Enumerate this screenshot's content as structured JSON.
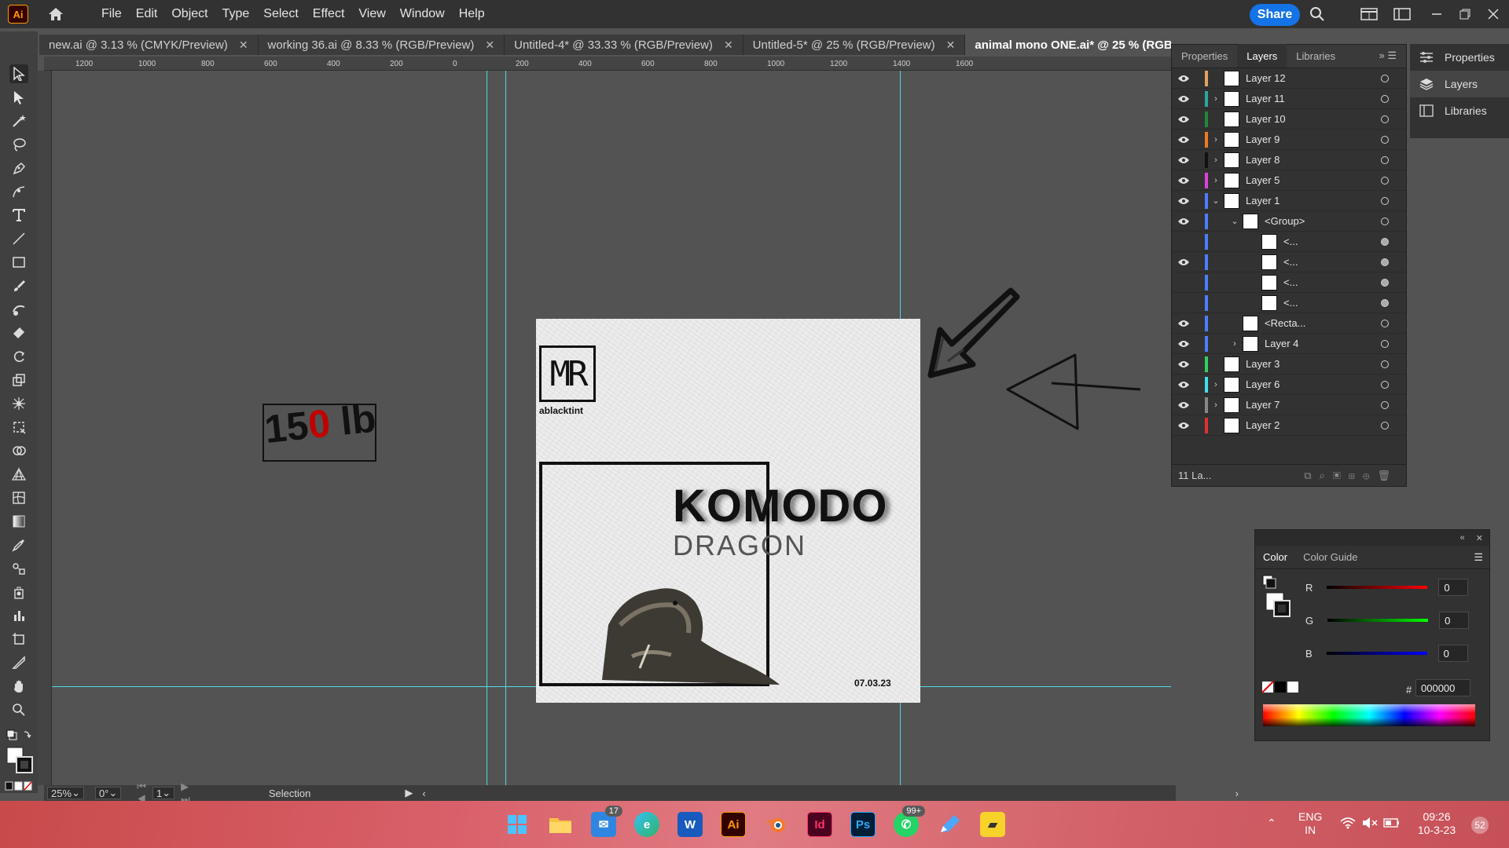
{
  "app": {
    "logo": "Ai"
  },
  "menu": [
    "File",
    "Edit",
    "Object",
    "Type",
    "Select",
    "Effect",
    "View",
    "Window",
    "Help"
  ],
  "share_label": "Share",
  "tabs": [
    {
      "label": "new.ai @ 3.13 % (CMYK/Preview)"
    },
    {
      "label": "working 36.ai @ 8.33 % (RGB/Preview)"
    },
    {
      "label": "Untitled-4* @ 33.33 % (RGB/Preview)"
    },
    {
      "label": "Untitled-5* @ 25 % (RGB/Preview)"
    },
    {
      "label": "animal mono ONE.ai* @ 25 % (RGB/Preview)"
    }
  ],
  "ruler_ticks": [
    "1200",
    "1000",
    "800",
    "600",
    "400",
    "200",
    "0",
    "200",
    "400",
    "600",
    "800",
    "1000",
    "1200",
    "1400",
    "1600"
  ],
  "artboard": {
    "logo_mark": "MR",
    "logo_text": "ablacktint",
    "title": "KOMODO",
    "subtitle": "DRAGON",
    "date": "07.03.23"
  },
  "weight_label": {
    "before": "15",
    "zero": "0",
    "after": " lb"
  },
  "statusbar": {
    "zoom": "25%",
    "rotation": "0°",
    "artboard_num": "1",
    "tool": "Selection"
  },
  "panel_tabs": [
    "Properties",
    "Layers",
    "Libraries"
  ],
  "layers": [
    {
      "name": "Layer 12",
      "color": "#e2a060",
      "indent": 0,
      "expand": "",
      "visible": true
    },
    {
      "name": "Layer 11",
      "color": "#2aa6a0",
      "indent": 0,
      "expand": "›",
      "visible": true
    },
    {
      "name": "Layer 10",
      "color": "#1e8a3a",
      "indent": 0,
      "expand": "",
      "visible": true
    },
    {
      "name": "Layer 9",
      "color": "#f07a20",
      "indent": 0,
      "expand": "›",
      "visible": true
    },
    {
      "name": "Layer 8",
      "color": "#111111",
      "indent": 0,
      "expand": "›",
      "visible": true
    },
    {
      "name": "Layer 5",
      "color": "#e040e0",
      "indent": 0,
      "expand": "›",
      "visible": true
    },
    {
      "name": "Layer 1",
      "color": "#4a7fff",
      "indent": 0,
      "expand": "⌄",
      "visible": true
    },
    {
      "name": "<Group>",
      "color": "#4a7fff",
      "indent": 1,
      "expand": "⌄",
      "visible": true
    },
    {
      "name": "<...",
      "color": "#4a7fff",
      "indent": 2,
      "expand": "",
      "visible": false
    },
    {
      "name": "<...",
      "color": "#4a7fff",
      "indent": 2,
      "expand": "",
      "visible": true
    },
    {
      "name": "<...",
      "color": "#4a7fff",
      "indent": 2,
      "expand": "",
      "visible": false
    },
    {
      "name": "<...",
      "color": "#4a7fff",
      "indent": 2,
      "expand": "",
      "visible": false
    },
    {
      "name": "<Recta...",
      "color": "#4a7fff",
      "indent": 1,
      "expand": "",
      "visible": true
    },
    {
      "name": "Layer 4",
      "color": "#4a7fff",
      "indent": 1,
      "expand": "›",
      "visible": true
    },
    {
      "name": "Layer 3",
      "color": "#30d060",
      "indent": 0,
      "expand": "",
      "visible": true
    },
    {
      "name": "Layer 6",
      "color": "#40e0f0",
      "indent": 0,
      "expand": "›",
      "visible": true
    },
    {
      "name": "Layer 7",
      "color": "#888888",
      "indent": 0,
      "expand": "›",
      "visible": true
    },
    {
      "name": "Layer 2",
      "color": "#e03030",
      "indent": 0,
      "expand": "",
      "visible": true
    }
  ],
  "layers_count": "11 La...",
  "dock": [
    "Properties",
    "Layers",
    "Libraries"
  ],
  "color_panel": {
    "tabs": [
      "Color",
      "Color Guide"
    ],
    "r": "0",
    "g": "0",
    "b": "0",
    "hex": "000000",
    "labels": {
      "r": "R",
      "g": "G",
      "b": "B",
      "hash": "#"
    }
  },
  "taskbar": {
    "mail_badge": "17",
    "whatsapp_badge": "99+",
    "lang_top": "ENG",
    "lang_bottom": "IN",
    "time": "09:26",
    "date": "10-3-23",
    "notif": "52"
  }
}
